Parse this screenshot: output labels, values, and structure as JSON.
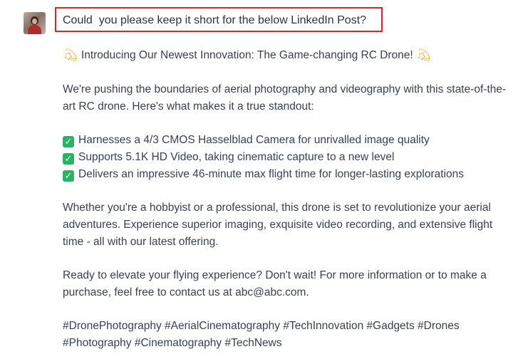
{
  "user": {
    "avatar_icon": "user-avatar",
    "prompt": "Could  you please keep it short for the below LinkedIn Post?"
  },
  "response": {
    "headline_icon": "dizzy-sparkle",
    "headline": "Introducing Our Newest Innovation: The Game-changing RC Drone!",
    "intro_line1": "We're pushing the boundaries of aerial photography and videography with this state-of-the-",
    "intro_line2": "art RC drone. Here's what makes it a true standout:",
    "features": [
      "Harnesses a 4/3 CMOS Hasselblad Camera for unrivalled image quality",
      "Supports 5.1K HD Video, taking cinematic capture to a new level",
      "Delivers an impressive 46-minute max flight time for longer-lasting explorations"
    ],
    "body_line1": "Whether you're a hobbyist or a professional, this drone is set to revolutionize your aerial",
    "body_line2": "adventures. Experience superior imaging, exquisite video recording, and extensive flight",
    "body_line3": "time - all with our latest offering.",
    "cta_line1": "Ready to elevate your flying experience? Don't wait! For more information or to make a",
    "cta_line2": "purchase, feel free to contact us at abc@abc.com.",
    "hashtags_line1": "#DronePhotography #AerialCinematography #TechInnovation #Gadgets #Drones",
    "hashtags_line2": "#Photography #Cinematography #TechNews"
  },
  "colors": {
    "highlight_border": "#e0202a",
    "check_green": "#28b463",
    "sparkle": "#f0a500",
    "text": "#374151"
  }
}
